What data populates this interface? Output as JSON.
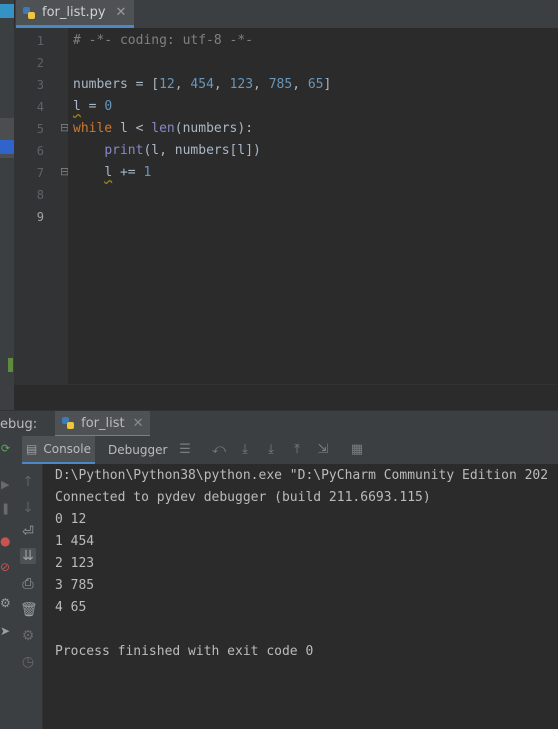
{
  "editor": {
    "tab": {
      "filename": "for_list.py"
    },
    "line_numbers": [
      "1",
      "2",
      "3",
      "4",
      "5",
      "6",
      "7",
      "8",
      "9"
    ],
    "code": {
      "line1": "# -*- coding: utf-8 -*-",
      "line3": {
        "var": "numbers",
        "op": " = [",
        "n1": "12",
        "n2": "454",
        "n3": "123",
        "n4": "785",
        "n5": "65",
        "close": "]"
      },
      "line4": {
        "var": "l",
        "op": " = ",
        "val": "0"
      },
      "line5": {
        "kw": "while",
        "mid": " l < ",
        "fn": "len",
        "args": "(numbers):"
      },
      "line6": {
        "fn": "print",
        "args": "(l, numbers[l])"
      },
      "line7": {
        "var": "l",
        "op": " += ",
        "val": "1"
      }
    },
    "current_line": "9"
  },
  "debug": {
    "label": "ebug:",
    "run_config": "for_list",
    "tabs": {
      "console": "Console",
      "debugger": "Debugger"
    },
    "console_lines": [
      "D:\\Python\\Python38\\python.exe \"D:\\PyCharm Community Edition 202",
      "Connected to pydev debugger (build 211.6693.115)",
      "0 12",
      "1 454",
      "2 123",
      "3 785",
      "4 65",
      "",
      "Process finished with exit code 0"
    ]
  },
  "colors": {
    "accent": "#4a88c7",
    "keyword": "#cc7832",
    "number": "#6897bb",
    "builtin": "#8888c6",
    "comment": "#808080"
  }
}
